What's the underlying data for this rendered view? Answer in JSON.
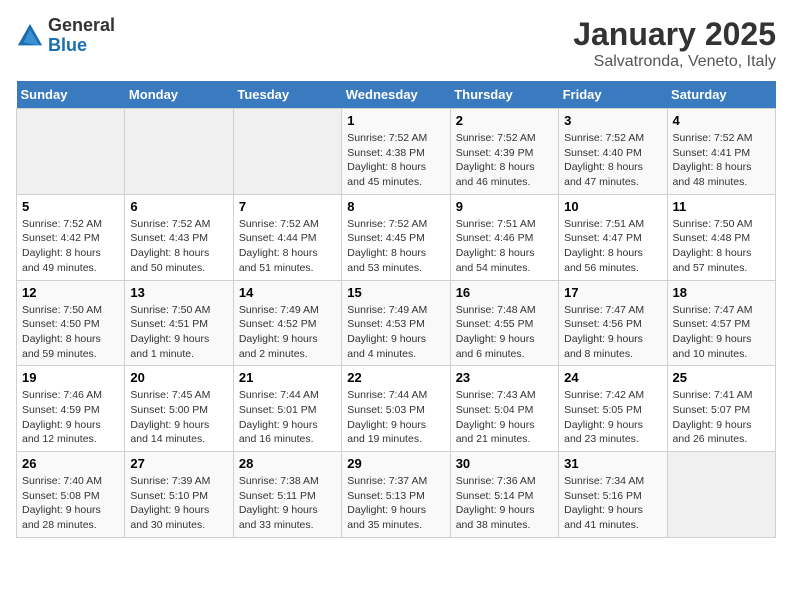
{
  "header": {
    "logo_line1": "General",
    "logo_line2": "Blue",
    "title": "January 2025",
    "subtitle": "Salvatronda, Veneto, Italy"
  },
  "days_of_week": [
    "Sunday",
    "Monday",
    "Tuesday",
    "Wednesday",
    "Thursday",
    "Friday",
    "Saturday"
  ],
  "weeks": [
    [
      {
        "day": "",
        "info": ""
      },
      {
        "day": "",
        "info": ""
      },
      {
        "day": "",
        "info": ""
      },
      {
        "day": "1",
        "info": "Sunrise: 7:52 AM\nSunset: 4:38 PM\nDaylight: 8 hours and 45 minutes."
      },
      {
        "day": "2",
        "info": "Sunrise: 7:52 AM\nSunset: 4:39 PM\nDaylight: 8 hours and 46 minutes."
      },
      {
        "day": "3",
        "info": "Sunrise: 7:52 AM\nSunset: 4:40 PM\nDaylight: 8 hours and 47 minutes."
      },
      {
        "day": "4",
        "info": "Sunrise: 7:52 AM\nSunset: 4:41 PM\nDaylight: 8 hours and 48 minutes."
      }
    ],
    [
      {
        "day": "5",
        "info": "Sunrise: 7:52 AM\nSunset: 4:42 PM\nDaylight: 8 hours and 49 minutes."
      },
      {
        "day": "6",
        "info": "Sunrise: 7:52 AM\nSunset: 4:43 PM\nDaylight: 8 hours and 50 minutes."
      },
      {
        "day": "7",
        "info": "Sunrise: 7:52 AM\nSunset: 4:44 PM\nDaylight: 8 hours and 51 minutes."
      },
      {
        "day": "8",
        "info": "Sunrise: 7:52 AM\nSunset: 4:45 PM\nDaylight: 8 hours and 53 minutes."
      },
      {
        "day": "9",
        "info": "Sunrise: 7:51 AM\nSunset: 4:46 PM\nDaylight: 8 hours and 54 minutes."
      },
      {
        "day": "10",
        "info": "Sunrise: 7:51 AM\nSunset: 4:47 PM\nDaylight: 8 hours and 56 minutes."
      },
      {
        "day": "11",
        "info": "Sunrise: 7:50 AM\nSunset: 4:48 PM\nDaylight: 8 hours and 57 minutes."
      }
    ],
    [
      {
        "day": "12",
        "info": "Sunrise: 7:50 AM\nSunset: 4:50 PM\nDaylight: 8 hours and 59 minutes."
      },
      {
        "day": "13",
        "info": "Sunrise: 7:50 AM\nSunset: 4:51 PM\nDaylight: 9 hours and 1 minute."
      },
      {
        "day": "14",
        "info": "Sunrise: 7:49 AM\nSunset: 4:52 PM\nDaylight: 9 hours and 2 minutes."
      },
      {
        "day": "15",
        "info": "Sunrise: 7:49 AM\nSunset: 4:53 PM\nDaylight: 9 hours and 4 minutes."
      },
      {
        "day": "16",
        "info": "Sunrise: 7:48 AM\nSunset: 4:55 PM\nDaylight: 9 hours and 6 minutes."
      },
      {
        "day": "17",
        "info": "Sunrise: 7:47 AM\nSunset: 4:56 PM\nDaylight: 9 hours and 8 minutes."
      },
      {
        "day": "18",
        "info": "Sunrise: 7:47 AM\nSunset: 4:57 PM\nDaylight: 9 hours and 10 minutes."
      }
    ],
    [
      {
        "day": "19",
        "info": "Sunrise: 7:46 AM\nSunset: 4:59 PM\nDaylight: 9 hours and 12 minutes."
      },
      {
        "day": "20",
        "info": "Sunrise: 7:45 AM\nSunset: 5:00 PM\nDaylight: 9 hours and 14 minutes."
      },
      {
        "day": "21",
        "info": "Sunrise: 7:44 AM\nSunset: 5:01 PM\nDaylight: 9 hours and 16 minutes."
      },
      {
        "day": "22",
        "info": "Sunrise: 7:44 AM\nSunset: 5:03 PM\nDaylight: 9 hours and 19 minutes."
      },
      {
        "day": "23",
        "info": "Sunrise: 7:43 AM\nSunset: 5:04 PM\nDaylight: 9 hours and 21 minutes."
      },
      {
        "day": "24",
        "info": "Sunrise: 7:42 AM\nSunset: 5:05 PM\nDaylight: 9 hours and 23 minutes."
      },
      {
        "day": "25",
        "info": "Sunrise: 7:41 AM\nSunset: 5:07 PM\nDaylight: 9 hours and 26 minutes."
      }
    ],
    [
      {
        "day": "26",
        "info": "Sunrise: 7:40 AM\nSunset: 5:08 PM\nDaylight: 9 hours and 28 minutes."
      },
      {
        "day": "27",
        "info": "Sunrise: 7:39 AM\nSunset: 5:10 PM\nDaylight: 9 hours and 30 minutes."
      },
      {
        "day": "28",
        "info": "Sunrise: 7:38 AM\nSunset: 5:11 PM\nDaylight: 9 hours and 33 minutes."
      },
      {
        "day": "29",
        "info": "Sunrise: 7:37 AM\nSunset: 5:13 PM\nDaylight: 9 hours and 35 minutes."
      },
      {
        "day": "30",
        "info": "Sunrise: 7:36 AM\nSunset: 5:14 PM\nDaylight: 9 hours and 38 minutes."
      },
      {
        "day": "31",
        "info": "Sunrise: 7:34 AM\nSunset: 5:16 PM\nDaylight: 9 hours and 41 minutes."
      },
      {
        "day": "",
        "info": ""
      }
    ]
  ]
}
